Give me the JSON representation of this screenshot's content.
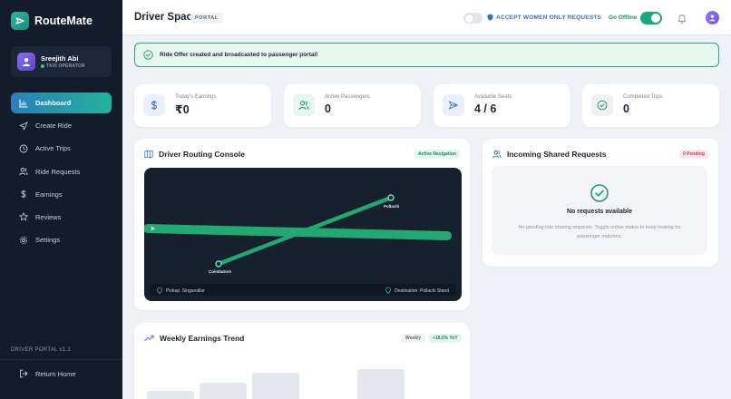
{
  "sidebar": {
    "brand": "RouteMate",
    "user": {
      "name": "Sreejith Abi",
      "role": "TAXI OPERATOR"
    },
    "nav": [
      {
        "label": "Dashboard",
        "icon": "bar-chart-icon",
        "active": true
      },
      {
        "label": "Create Ride",
        "icon": "navigation-icon"
      },
      {
        "label": "Active Trips",
        "icon": "clock-icon"
      },
      {
        "label": "Ride Requests",
        "icon": "users-icon"
      },
      {
        "label": "Earnings",
        "icon": "dollar-icon"
      },
      {
        "label": "Reviews",
        "icon": "star-icon"
      },
      {
        "label": "Settings",
        "icon": "gear-icon"
      }
    ],
    "version": "DRIVER PORTAL v1.1",
    "return_home": "Return Home"
  },
  "header": {
    "title": "Driver Space",
    "badge": "PORTAL",
    "women_only_label": "ACCEPT WOMEN ONLY REQUESTS",
    "go_offline_label": "Go Offline"
  },
  "alert": {
    "message": "Ride Offer created and broadcasted to passenger portal!"
  },
  "stats": [
    {
      "label": "Today's Earnings",
      "value": "₹0",
      "icon": "dollar-icon"
    },
    {
      "label": "Active Passengers",
      "value": "0",
      "icon": "users-icon"
    },
    {
      "label": "Available Seats",
      "value": "4 / 6",
      "icon": "send-icon"
    },
    {
      "label": "Completed Trips",
      "value": "0",
      "icon": "check-circle-icon"
    }
  ],
  "routing": {
    "title": "Driver Routing Console",
    "status": "Active Navigation",
    "origin_label": "Coimbatore",
    "destination_label": "Pollachi",
    "pickup": "Pickup: Singanallur",
    "destination": "Destination: Pollachi Stand"
  },
  "requests": {
    "title": "Incoming Shared Requests",
    "badge": "0 Pending",
    "empty_title": "No requests available",
    "empty_desc": "No pending ride sharing requests. Toggle online status to keep looking for passenger matches."
  },
  "earnings": {
    "title": "Weekly Earnings Trend",
    "period": "Weekly",
    "change": "+18.5% YoY"
  },
  "colors": {
    "accent": "#1fa37f",
    "sidebar": "#141c2c",
    "alert_border": "#2da37e",
    "route": "#22a873"
  }
}
